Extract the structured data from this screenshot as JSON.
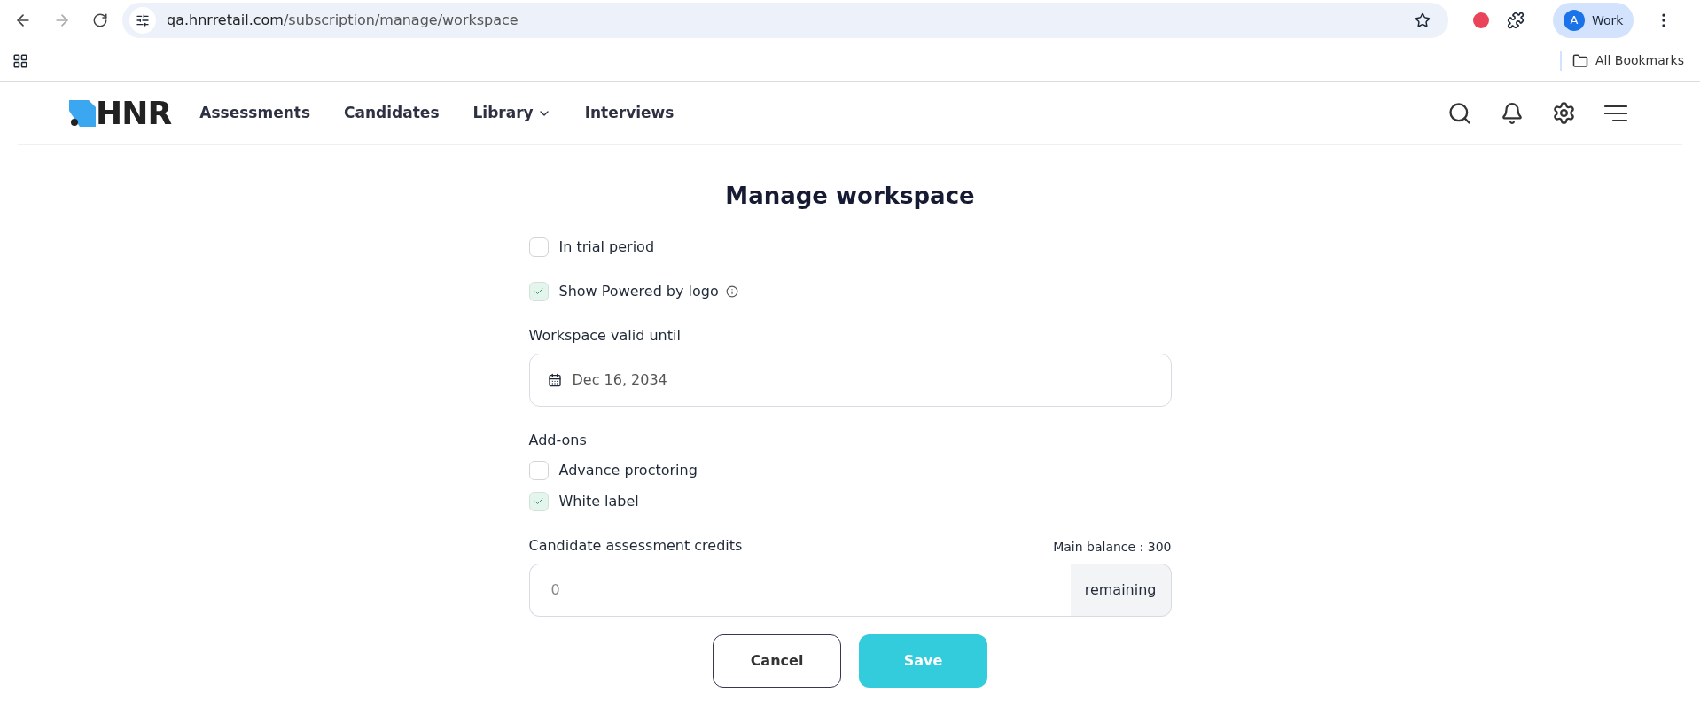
{
  "browser": {
    "url_host": "qa.hnrretail.com",
    "url_path": "/subscription/manage/workspace",
    "profile": {
      "initial": "A",
      "label": "Work"
    },
    "bookmarks": [
      "All Bookmarks"
    ]
  },
  "nav": {
    "logo": "HNR",
    "items": [
      {
        "label": "Assessments",
        "dropdown": false
      },
      {
        "label": "Candidates",
        "dropdown": false
      },
      {
        "label": "Library",
        "dropdown": true
      },
      {
        "label": "Interviews",
        "dropdown": false
      }
    ]
  },
  "form": {
    "title": "Manage workspace",
    "options": [
      {
        "label": "In trial period",
        "checked": false,
        "info": false
      },
      {
        "label": "Show Powered by logo",
        "checked": true,
        "info": true
      }
    ],
    "valid_until": {
      "label": "Workspace valid until",
      "value": "Dec 16, 2034"
    },
    "addons": {
      "label": "Add-ons",
      "items": [
        {
          "label": "Advance proctoring",
          "checked": false
        },
        {
          "label": "White label",
          "checked": true
        }
      ]
    },
    "credits": {
      "label": "Candidate assessment credits",
      "balance": "Main balance : 300",
      "placeholder": "0",
      "suffix": "remaining"
    },
    "buttons": [
      {
        "label": "Cancel",
        "kind": "secondary"
      },
      {
        "label": "Save",
        "kind": "primary"
      }
    ]
  }
}
